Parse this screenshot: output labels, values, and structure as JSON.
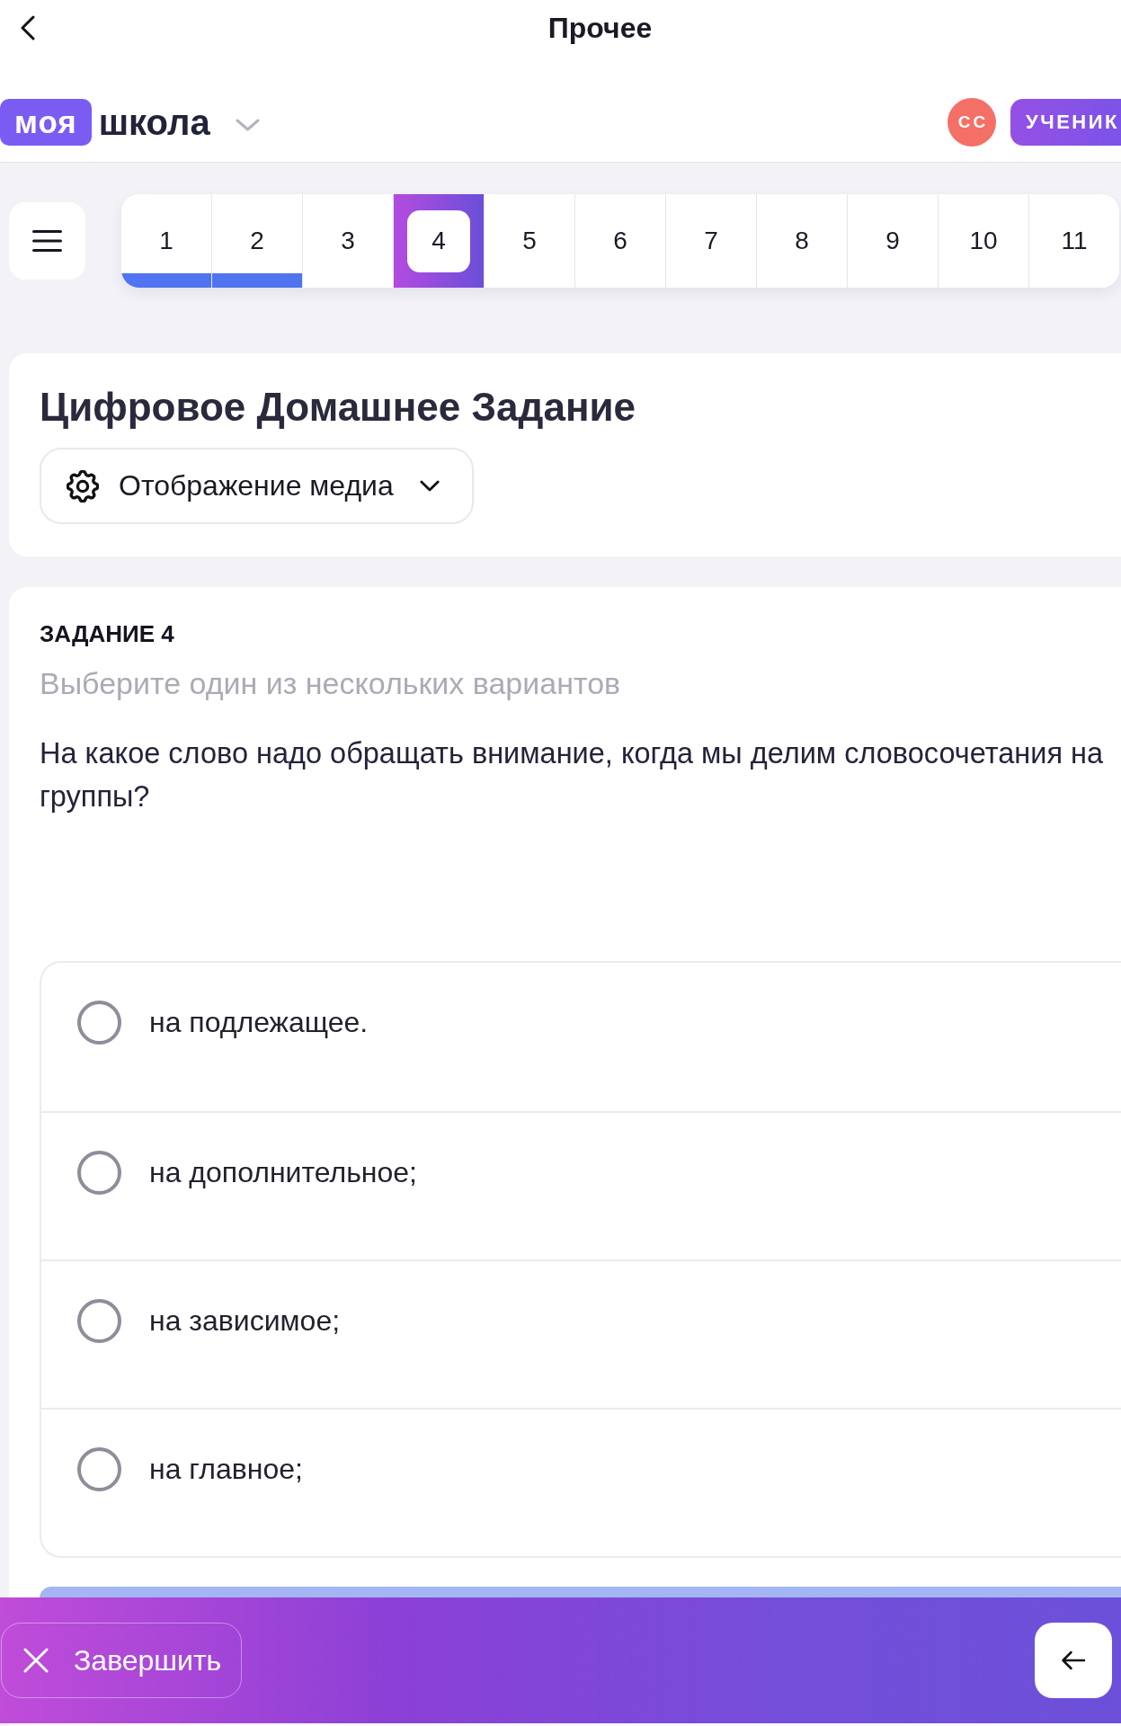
{
  "top_bar": {
    "title": "Прочее"
  },
  "header": {
    "logo_badge": "моя",
    "logo_text": "школа",
    "avatar": "СС",
    "role": "УЧЕНИК"
  },
  "question_tabs": [
    {
      "label": "1",
      "selected": false,
      "answered": true
    },
    {
      "label": "2",
      "selected": false,
      "answered": true
    },
    {
      "label": "3",
      "selected": false,
      "answered": false
    },
    {
      "label": "4",
      "selected": true,
      "answered": false
    },
    {
      "label": "5",
      "selected": false,
      "answered": false
    },
    {
      "label": "6",
      "selected": false,
      "answered": false
    },
    {
      "label": "7",
      "selected": false,
      "answered": false
    },
    {
      "label": "8",
      "selected": false,
      "answered": false
    },
    {
      "label": "9",
      "selected": false,
      "answered": false
    },
    {
      "label": "10",
      "selected": false,
      "answered": false
    },
    {
      "label": "11",
      "selected": false,
      "answered": false
    }
  ],
  "homework": {
    "title": "Цифровое Домашнее Задание",
    "media_dropdown": "Отображение медиа"
  },
  "task": {
    "heading": "ЗАДАНИЕ 4",
    "instruction": "Выберите один из нескольких вариантов",
    "question": "На какое слово надо обращать внимание, когда мы делим словосочетания на группы?",
    "options": [
      {
        "label": "на подлежащее.",
        "selected": false
      },
      {
        "label": "на дополнительное;",
        "selected": false
      },
      {
        "label": "на зависимое;",
        "selected": false
      },
      {
        "label": "на главное;",
        "selected": false
      }
    ]
  },
  "bottom_bar": {
    "finish_button": "Завершить"
  }
}
